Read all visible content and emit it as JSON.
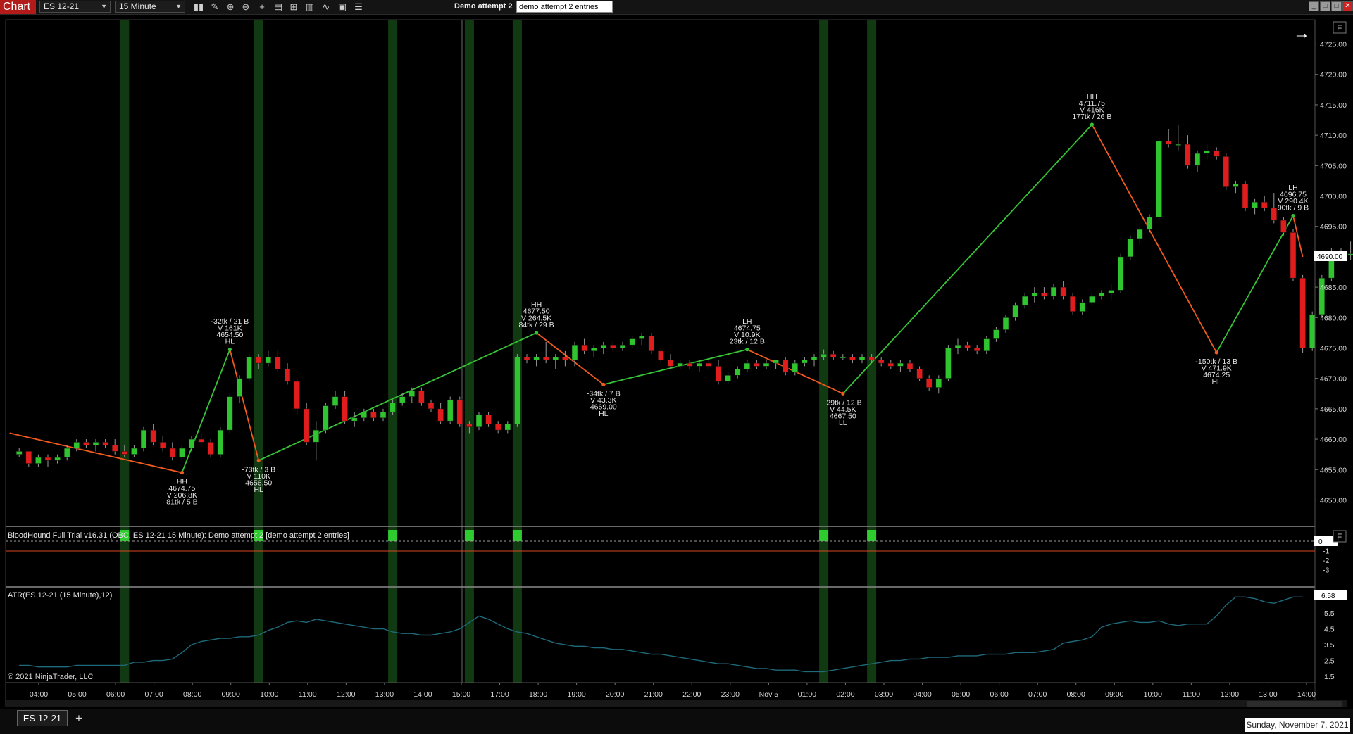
{
  "window": {
    "tab_label": "Chart",
    "instrument": "ES 12-21",
    "interval": "15 Minute",
    "template_label": "Demo attempt 2",
    "template_input": "demo attempt 2 entries",
    "minimize": "_",
    "restore": "□",
    "close": "✕"
  },
  "toolbar_icons": [
    "bars-type-icon",
    "draw-pencil-icon",
    "zoom-in-icon",
    "zoom-out-icon",
    "crosshair-icon",
    "data-box-icon",
    "templates-icon",
    "indicators-icon",
    "strategies-icon",
    "properties-icon",
    "object-list-icon"
  ],
  "colors": {
    "up_candle": "#2fc52f",
    "down_candle": "#e01c1c",
    "zigzag_up": "#35c435",
    "zigzag_down": "#f05a1e",
    "signal_bar": "#123a12",
    "atr_line": "#1f6a7a",
    "price_marker": "#ffffff"
  },
  "price_panel": {
    "right_arrow_icon": "arrow-right-icon",
    "f_button": "F",
    "current_price": "4690.00",
    "price_axis": [
      "4725.00",
      "4720.00",
      "4715.00",
      "4710.00",
      "4705.00",
      "4700.00",
      "4695.00",
      "4690.00",
      "4685.00",
      "4680.00",
      "4675.00",
      "4670.00",
      "4665.00",
      "4660.00",
      "4655.00",
      "4650.00"
    ],
    "swing_labels": [
      {
        "lines": [
          "HH",
          "4674.75",
          "V 206.8K",
          "81tk / 5 B"
        ]
      },
      {
        "lines": [
          "-32tk / 21 B",
          "V 161K",
          "4654.50",
          "HL"
        ]
      },
      {
        "lines": [
          "-73tk / 3 B",
          "V 110K",
          "4656.50",
          "HL"
        ]
      },
      {
        "lines": [
          "HH",
          "4677.50",
          "V 264.5K",
          "84tk / 29 B"
        ]
      },
      {
        "lines": [
          "-34tk / 7 B",
          "V 43.3K",
          "4669.00",
          "HL"
        ]
      },
      {
        "lines": [
          "LH",
          "4674.75",
          "V 10.9K",
          "23tk / 12 B"
        ]
      },
      {
        "lines": [
          "-29tk / 12 B",
          "V 44.5K",
          "4667.50",
          "LL"
        ]
      },
      {
        "lines": [
          "HH",
          "4711.75",
          "V 416K",
          "177tk / 26 B"
        ]
      },
      {
        "lines": [
          "-150tk / 13 B",
          "V 471.9K",
          "4674.25",
          "HL"
        ]
      },
      {
        "lines": [
          "LH",
          "4696.75",
          "V 290.4K",
          "90tk / 9 B"
        ]
      }
    ]
  },
  "bloodhound_panel": {
    "title": "BloodHound Full Trial v16.31 (OBC, ES 12-21 15 Minute): Demo attempt 2  [demo attempt 2 entries]",
    "f_button": "F",
    "axis": [
      "0",
      "-1",
      "-2",
      "-3"
    ],
    "current_value": "0"
  },
  "atr_panel": {
    "title": "ATR(ES 12-21 (15 Minute),12)",
    "current_value": "6.58",
    "axis": [
      "5.5",
      "4.5",
      "3.5",
      "2.5",
      "1.5"
    ]
  },
  "copyright": "© 2021 NinjaTrader, LLC",
  "time_axis": [
    "04:00",
    "05:00",
    "06:00",
    "07:00",
    "08:00",
    "09:00",
    "10:00",
    "11:00",
    "12:00",
    "13:00",
    "14:00",
    "15:00",
    "17:00",
    "18:00",
    "19:00",
    "20:00",
    "21:00",
    "22:00",
    "23:00",
    "Nov 5",
    "01:00",
    "02:00",
    "03:00",
    "04:00",
    "05:00",
    "06:00",
    "07:00",
    "08:00",
    "09:00",
    "10:00",
    "11:00",
    "12:00",
    "13:00",
    "14:00"
  ],
  "status": {
    "instrument_tab": "ES 12-21",
    "add_tab": "+",
    "date": "Sunday, November 7, 2021"
  },
  "chart_data": {
    "type": "candlestick",
    "instrument": "ES 12-21",
    "bar_period": "15 Minute",
    "ohlc": [
      [
        4657.5,
        4658.5,
        4657.0,
        4658.0
      ],
      [
        4658.0,
        4658.0,
        4655.5,
        4656.0
      ],
      [
        4656.0,
        4657.5,
        4655.5,
        4657.0
      ],
      [
        4657.0,
        4657.5,
        4655.5,
        4656.5
      ],
      [
        4656.5,
        4657.5,
        4656.0,
        4657.0
      ],
      [
        4657.0,
        4659.0,
        4656.5,
        4658.5
      ],
      [
        4658.5,
        4660.0,
        4658.0,
        4659.5
      ],
      [
        4659.5,
        4660.0,
        4658.5,
        4659.0
      ],
      [
        4659.0,
        4660.0,
        4658.0,
        4659.5
      ],
      [
        4659.5,
        4660.0,
        4658.5,
        4659.0
      ],
      [
        4659.0,
        4660.0,
        4657.5,
        4658.0
      ],
      [
        4658.0,
        4659.0,
        4657.0,
        4657.5
      ],
      [
        4657.5,
        4659.0,
        4657.0,
        4658.5
      ],
      [
        4658.5,
        4662.0,
        4658.0,
        4661.5
      ],
      [
        4661.5,
        4662.5,
        4659.0,
        4659.5
      ],
      [
        4659.5,
        4660.5,
        4658.0,
        4658.5
      ],
      [
        4658.5,
        4659.5,
        4656.5,
        4657.0
      ],
      [
        4657.0,
        4659.0,
        4656.5,
        4658.5
      ],
      [
        4658.5,
        4660.5,
        4658.0,
        4660.0
      ],
      [
        4660.0,
        4661.0,
        4659.0,
        4659.5
      ],
      [
        4659.5,
        4660.0,
        4657.0,
        4657.5
      ],
      [
        4657.5,
        4662.0,
        4657.0,
        4661.5
      ],
      [
        4661.5,
        4667.5,
        4661.0,
        4667.0
      ],
      [
        4667.0,
        4670.5,
        4666.0,
        4670.0
      ],
      [
        4670.0,
        4674.0,
        4669.5,
        4673.5
      ],
      [
        4673.5,
        4674.0,
        4671.5,
        4672.5
      ],
      [
        4672.5,
        4674.5,
        4672.0,
        4673.5
      ],
      [
        4673.5,
        4674.75,
        4671.0,
        4671.5
      ],
      [
        4671.5,
        4672.5,
        4669.0,
        4669.5
      ],
      [
        4669.5,
        4670.0,
        4664.0,
        4665.0
      ],
      [
        4665.0,
        4666.0,
        4659.0,
        4659.5
      ],
      [
        4659.5,
        4663.0,
        4656.5,
        4661.5
      ],
      [
        4661.5,
        4666.0,
        4661.0,
        4665.5
      ],
      [
        4665.5,
        4668.0,
        4665.0,
        4667.0
      ],
      [
        4667.0,
        4668.0,
        4662.5,
        4663.0
      ],
      [
        4663.0,
        4664.5,
        4662.0,
        4663.5
      ],
      [
        4663.5,
        4665.0,
        4663.0,
        4664.5
      ],
      [
        4664.5,
        4665.0,
        4663.0,
        4663.5
      ],
      [
        4663.5,
        4665.0,
        4663.0,
        4664.5
      ],
      [
        4664.5,
        4666.5,
        4664.0,
        4666.0
      ],
      [
        4666.0,
        4667.5,
        4665.5,
        4667.0
      ],
      [
        4667.0,
        4668.5,
        4666.0,
        4668.0
      ],
      [
        4668.0,
        4668.5,
        4665.5,
        4666.0
      ],
      [
        4666.0,
        4666.5,
        4664.5,
        4665.0
      ],
      [
        4665.0,
        4666.0,
        4662.5,
        4663.0
      ],
      [
        4663.0,
        4667.0,
        4662.5,
        4666.5
      ],
      [
        4666.5,
        4667.0,
        4662.0,
        4662.5
      ],
      [
        4662.5,
        4663.0,
        4661.0,
        4662.0
      ],
      [
        4662.0,
        4664.5,
        4661.5,
        4664.0
      ],
      [
        4664.0,
        4664.5,
        4662.0,
        4662.5
      ],
      [
        4662.5,
        4663.0,
        4661.0,
        4661.5
      ],
      [
        4661.5,
        4663.0,
        4661.0,
        4662.5
      ],
      [
        4662.5,
        4674.0,
        4662.0,
        4673.5
      ],
      [
        4673.5,
        4674.0,
        4672.5,
        4673.0
      ],
      [
        4673.0,
        4674.0,
        4672.0,
        4673.5
      ],
      [
        4673.5,
        4676.0,
        4672.5,
        4673.0
      ],
      [
        4673.0,
        4674.0,
        4671.5,
        4673.5
      ],
      [
        4673.5,
        4674.5,
        4672.0,
        4673.0
      ],
      [
        4673.0,
        4676.0,
        4672.0,
        4675.5
      ],
      [
        4675.5,
        4676.5,
        4674.0,
        4674.5
      ],
      [
        4674.5,
        4675.5,
        4673.5,
        4675.0
      ],
      [
        4675.0,
        4676.0,
        4674.0,
        4675.5
      ],
      [
        4675.5,
        4676.0,
        4674.5,
        4675.0
      ],
      [
        4675.0,
        4676.0,
        4674.5,
        4675.5
      ],
      [
        4675.5,
        4677.0,
        4675.0,
        4676.5
      ],
      [
        4676.5,
        4677.5,
        4675.5,
        4677.0
      ],
      [
        4677.0,
        4677.5,
        4674.0,
        4674.5
      ],
      [
        4674.5,
        4675.0,
        4672.5,
        4673.0
      ],
      [
        4673.0,
        4674.0,
        4671.5,
        4672.0
      ],
      [
        4672.0,
        4673.0,
        4671.5,
        4672.5
      ],
      [
        4672.5,
        4673.0,
        4671.5,
        4672.0
      ],
      [
        4672.0,
        4673.0,
        4671.0,
        4672.5
      ],
      [
        4672.5,
        4673.5,
        4671.5,
        4672.0
      ],
      [
        4672.0,
        4673.0,
        4669.0,
        4669.5
      ],
      [
        4669.5,
        4671.0,
        4669.0,
        4670.5
      ],
      [
        4670.5,
        4672.0,
        4670.0,
        4671.5
      ],
      [
        4671.5,
        4673.0,
        4671.0,
        4672.5
      ],
      [
        4672.5,
        4673.0,
        4671.5,
        4672.0
      ],
      [
        4672.0,
        4673.0,
        4671.5,
        4672.5
      ],
      [
        4672.5,
        4673.0,
        4671.5,
        4673.0
      ],
      [
        4673.0,
        4673.5,
        4670.5,
        4671.0
      ],
      [
        4671.0,
        4673.0,
        4670.5,
        4672.5
      ],
      [
        4672.5,
        4673.5,
        4672.0,
        4673.0
      ],
      [
        4673.0,
        4674.0,
        4672.0,
        4673.5
      ],
      [
        4673.5,
        4674.75,
        4673.0,
        4674.0
      ],
      [
        4674.0,
        4674.5,
        4673.0,
        4673.5
      ],
      [
        4673.5,
        4674.0,
        4673.0,
        4673.5
      ],
      [
        4673.5,
        4674.0,
        4672.5,
        4673.0
      ],
      [
        4673.0,
        4674.0,
        4672.5,
        4673.5
      ],
      [
        4673.5,
        4674.0,
        4672.5,
        4673.0
      ],
      [
        4673.0,
        4673.5,
        4672.0,
        4672.5
      ],
      [
        4672.5,
        4673.0,
        4671.5,
        4672.0
      ],
      [
        4672.0,
        4673.0,
        4671.0,
        4672.5
      ],
      [
        4672.5,
        4673.0,
        4671.0,
        4671.5
      ],
      [
        4671.5,
        4672.0,
        4669.5,
        4670.0
      ],
      [
        4670.0,
        4670.5,
        4668.0,
        4668.5
      ],
      [
        4668.5,
        4670.5,
        4667.5,
        4670.0
      ],
      [
        4670.0,
        4675.5,
        4669.5,
        4675.0
      ],
      [
        4675.0,
        4676.5,
        4674.0,
        4675.5
      ],
      [
        4675.5,
        4676.0,
        4674.5,
        4675.0
      ],
      [
        4675.0,
        4675.5,
        4674.0,
        4674.5
      ],
      [
        4674.5,
        4677.0,
        4674.0,
        4676.5
      ],
      [
        4676.5,
        4678.5,
        4676.0,
        4678.0
      ],
      [
        4678.0,
        4680.5,
        4677.5,
        4680.0
      ],
      [
        4680.0,
        4682.5,
        4679.5,
        4682.0
      ],
      [
        4682.0,
        4684.0,
        4681.5,
        4683.5
      ],
      [
        4683.5,
        4685.0,
        4682.5,
        4684.0
      ],
      [
        4684.0,
        4685.0,
        4683.0,
        4683.5
      ],
      [
        4683.5,
        4685.5,
        4683.0,
        4685.0
      ],
      [
        4685.0,
        4686.0,
        4683.0,
        4683.5
      ],
      [
        4683.5,
        4684.0,
        4680.5,
        4681.0
      ],
      [
        4681.0,
        4683.0,
        4680.5,
        4682.5
      ],
      [
        4682.5,
        4684.0,
        4682.0,
        4683.5
      ],
      [
        4683.5,
        4684.5,
        4683.0,
        4684.0
      ],
      [
        4684.0,
        4685.5,
        4683.0,
        4684.5
      ],
      [
        4684.5,
        4690.5,
        4684.0,
        4690.0
      ],
      [
        4690.0,
        4693.5,
        4689.5,
        4693.0
      ],
      [
        4693.0,
        4695.0,
        4692.0,
        4694.5
      ],
      [
        4694.5,
        4697.0,
        4694.0,
        4696.5
      ],
      [
        4696.5,
        4709.5,
        4696.0,
        4709.0
      ],
      [
        4709.0,
        4711.0,
        4708.0,
        4708.5
      ],
      [
        4708.5,
        4711.75,
        4707.5,
        4708.5
      ],
      [
        4708.5,
        4710.0,
        4704.5,
        4705.0
      ],
      [
        4705.0,
        4707.5,
        4704.0,
        4707.0
      ],
      [
        4707.0,
        4708.5,
        4706.0,
        4707.5
      ],
      [
        4707.5,
        4708.0,
        4706.0,
        4706.5
      ],
      [
        4706.5,
        4707.0,
        4701.0,
        4701.5
      ],
      [
        4701.5,
        4702.5,
        4700.5,
        4702.0
      ],
      [
        4702.0,
        4702.5,
        4697.5,
        4698.0
      ],
      [
        4698.0,
        4699.5,
        4697.0,
        4699.0
      ],
      [
        4699.0,
        4700.0,
        4697.5,
        4698.0
      ],
      [
        4698.0,
        4700.5,
        4695.5,
        4696.0
      ],
      [
        4696.0,
        4696.5,
        4693.5,
        4694.0
      ],
      [
        4694.0,
        4694.5,
        4686.0,
        4686.5
      ],
      [
        4686.5,
        4687.0,
        4674.25,
        4675.0
      ],
      [
        4675.0,
        4681.0,
        4674.5,
        4680.5
      ],
      [
        4680.5,
        4687.0,
        4680.0,
        4686.5
      ],
      [
        4686.5,
        4691.5,
        4686.0,
        4691.0
      ],
      [
        4691.0,
        4691.5,
        4689.5,
        4690.5
      ],
      [
        4690.5,
        4692.5,
        4689.5,
        4690.5
      ],
      [
        4690.5,
        4692.0,
        4690.0,
        4691.0
      ],
      [
        4691.0,
        4692.5,
        4689.0,
        4689.5
      ],
      [
        4689.5,
        4692.0,
        4689.0,
        4691.0
      ],
      [
        4691.0,
        4691.5,
        4687.0,
        4687.5
      ],
      [
        4687.5,
        4691.0,
        4686.5,
        4690.5
      ],
      [
        4690.5,
        4696.75,
        4690.0,
        4690.0
      ]
    ],
    "zigzag": [
      {
        "bar": -1,
        "price": 4661.0
      },
      {
        "bar": 17,
        "price": 4654.5
      },
      {
        "bar": 22,
        "price": 4674.75
      },
      {
        "bar": 25,
        "price": 4656.5
      },
      {
        "bar": 54,
        "price": 4677.5
      },
      {
        "bar": 61,
        "price": 4669.0
      },
      {
        "bar": 76,
        "price": 4674.75
      },
      {
        "bar": 86,
        "price": 4667.5
      },
      {
        "bar": 112,
        "price": 4711.75
      },
      {
        "bar": 125,
        "price": 4674.25
      },
      {
        "bar": 133,
        "price": 4696.75
      },
      {
        "bar": 134,
        "price": 4690.0
      }
    ],
    "signal_bars": [
      11,
      25,
      39,
      47,
      52,
      84,
      89
    ],
    "atr": [
      2.2,
      2.2,
      2.1,
      2.1,
      2.1,
      2.1,
      2.2,
      2.2,
      2.2,
      2.2,
      2.2,
      2.2,
      2.4,
      2.4,
      2.5,
      2.5,
      2.6,
      3.0,
      3.5,
      3.7,
      3.8,
      3.9,
      3.9,
      4.0,
      4.0,
      4.1,
      4.4,
      4.6,
      4.9,
      5.0,
      4.9,
      5.1,
      5.0,
      4.9,
      4.8,
      4.7,
      4.6,
      4.5,
      4.5,
      4.3,
      4.2,
      4.2,
      4.1,
      4.1,
      4.2,
      4.3,
      4.5,
      4.9,
      5.3,
      5.1,
      4.8,
      4.5,
      4.3,
      4.2,
      4.0,
      3.8,
      3.6,
      3.5,
      3.4,
      3.4,
      3.3,
      3.3,
      3.2,
      3.2,
      3.1,
      3.0,
      2.9,
      2.9,
      2.8,
      2.7,
      2.6,
      2.5,
      2.4,
      2.3,
      2.3,
      2.2,
      2.1,
      2.0,
      2.0,
      1.9,
      1.9,
      1.9,
      1.8,
      1.8,
      1.8,
      1.9,
      2.0,
      2.1,
      2.2,
      2.3,
      2.4,
      2.5,
      2.5,
      2.6,
      2.6,
      2.7,
      2.7,
      2.7,
      2.8,
      2.8,
      2.8,
      2.9,
      2.9,
      2.9,
      3.0,
      3.0,
      3.0,
      3.1,
      3.2,
      3.6,
      3.7,
      3.8,
      4.0,
      4.6,
      4.8,
      4.9,
      5.0,
      4.9,
      4.9,
      5.0,
      4.8,
      4.7,
      4.8,
      4.8,
      4.8,
      5.3,
      6.0,
      6.5,
      6.5,
      6.4,
      6.2,
      6.1,
      6.3,
      6.5,
      6.5
    ],
    "ylim": [
      4646.0,
      4729.0
    ],
    "atr_ylim": [
      1.2,
      7.0
    ]
  }
}
